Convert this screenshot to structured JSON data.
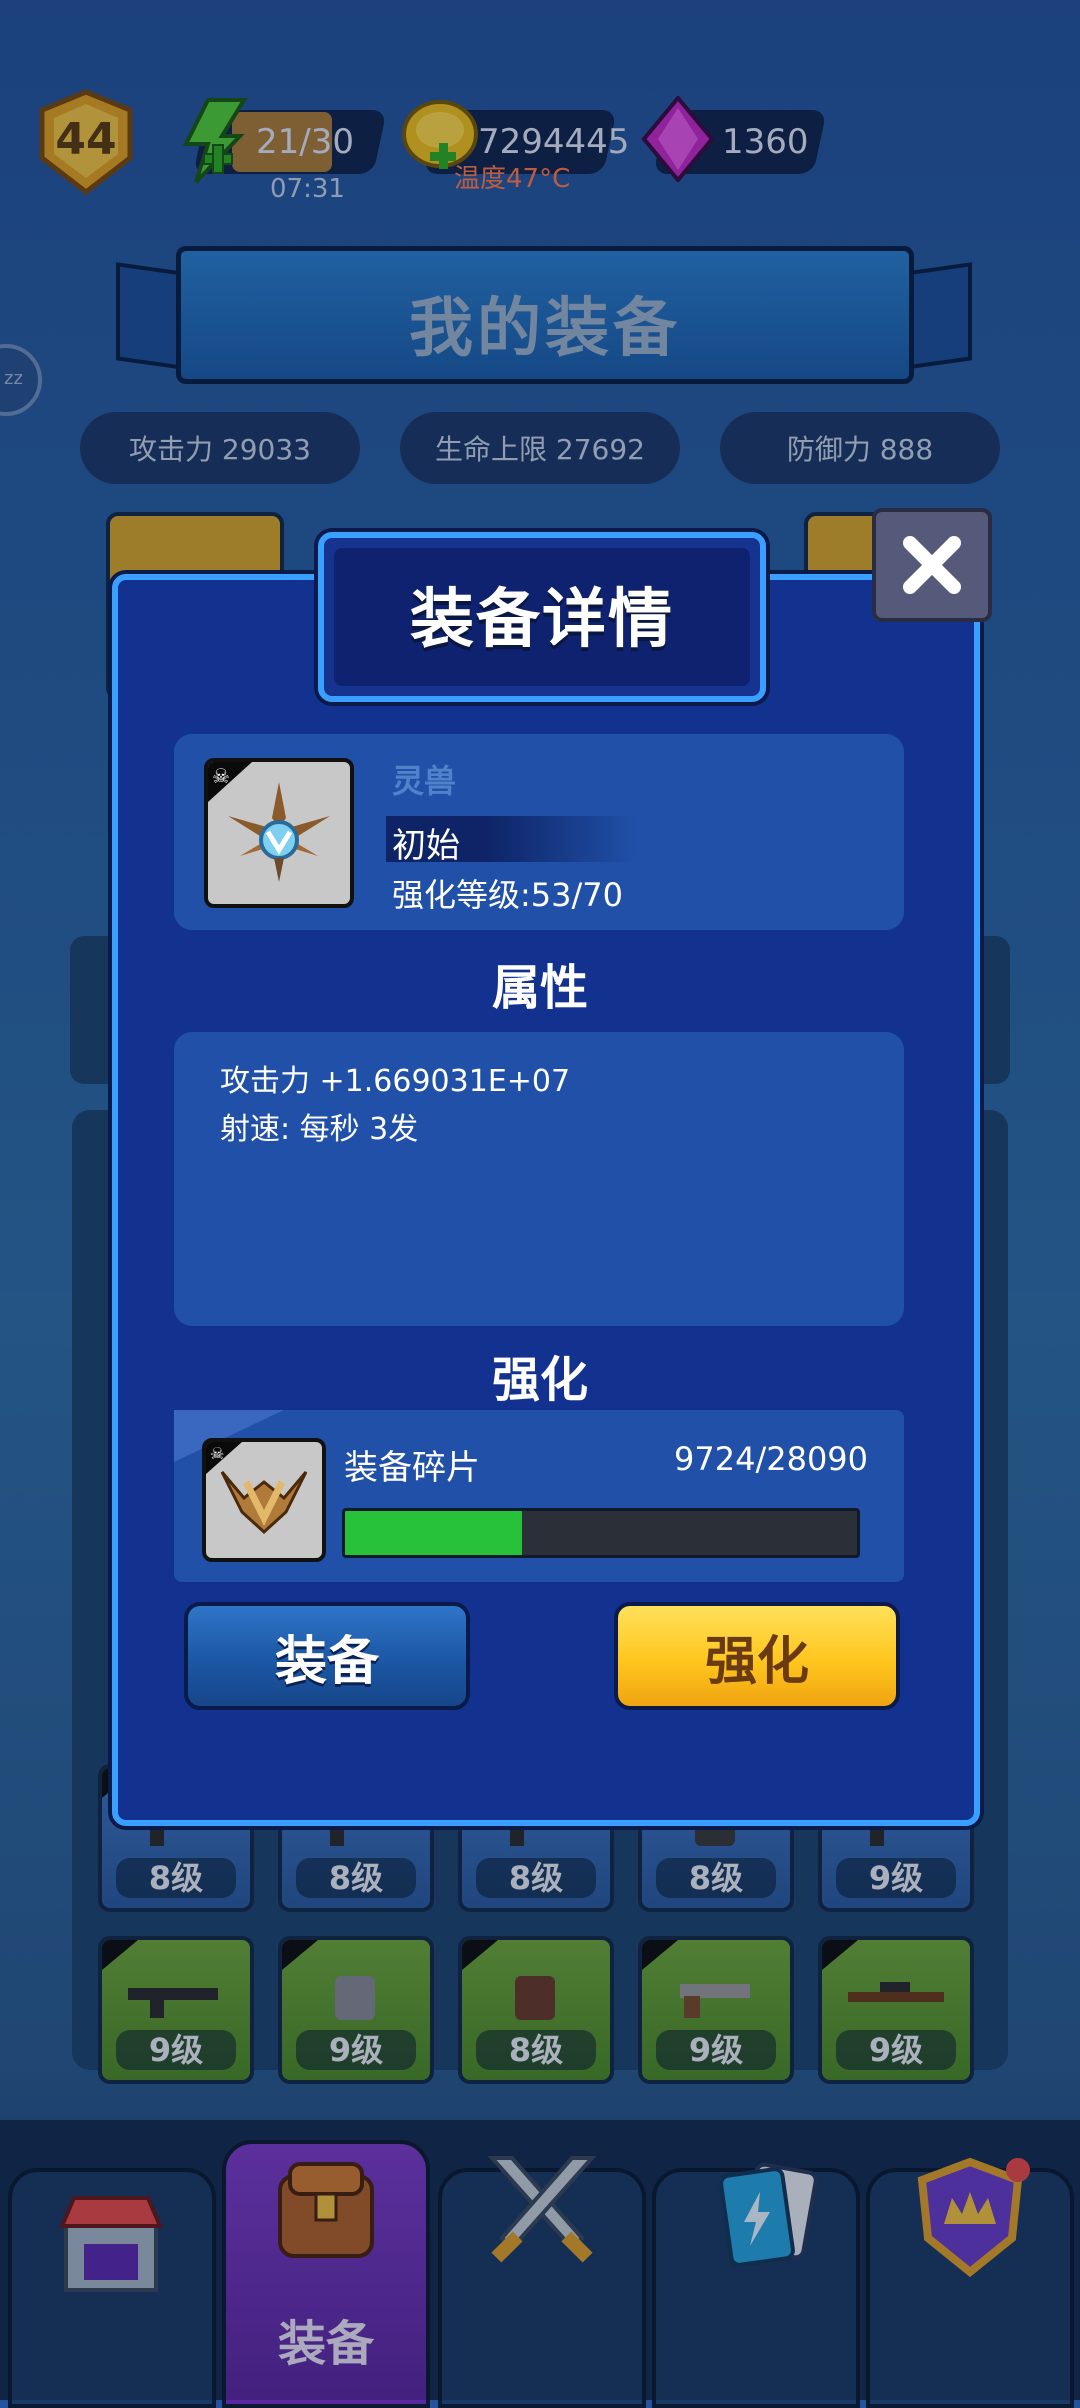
{
  "top_bar": {
    "level": "44",
    "energy_value": "21/30",
    "energy_timer": "07:31",
    "coins_value": "7294445",
    "temperature": "温度47°C",
    "gems_value": "1360"
  },
  "header": {
    "title": "我的装备",
    "side_button_label": "zz"
  },
  "stats": [
    {
      "label": "攻击力 29033"
    },
    {
      "label": "生命上限 27692"
    },
    {
      "label": "防御力 888"
    }
  ],
  "grid": {
    "row1": [
      "8级",
      "8级",
      "8级",
      "8级",
      "9级"
    ],
    "row2": [
      "9级",
      "9级",
      "8级",
      "9级",
      "9级"
    ]
  },
  "modal": {
    "title": "装备详情",
    "item_type": "灵兽",
    "item_quality": "初始",
    "enhance_level": "强化等级:53/70",
    "attributes_title": "属性",
    "attributes": [
      "攻击力 +1.669031E+07",
      "射速: 每秒 3发"
    ],
    "enhance_title": "强化",
    "material_name": "装备碎片",
    "material_count": "9724/28090",
    "material_progress": 0.346,
    "equip_button": "装备",
    "upgrade_button": "强化"
  },
  "nav": {
    "active_label": "装备",
    "tabs": [
      "shop-icon",
      "backpack-icon",
      "crossed-swords-icon",
      "cards-icon",
      "crown-shield-icon"
    ]
  },
  "colors": {
    "modal_border": "#3aa0ff",
    "modal_bg": "#13328f",
    "progress_fill": "#27c23a",
    "upgrade_button": "#ffc61e",
    "equip_button": "#1b57a4"
  }
}
